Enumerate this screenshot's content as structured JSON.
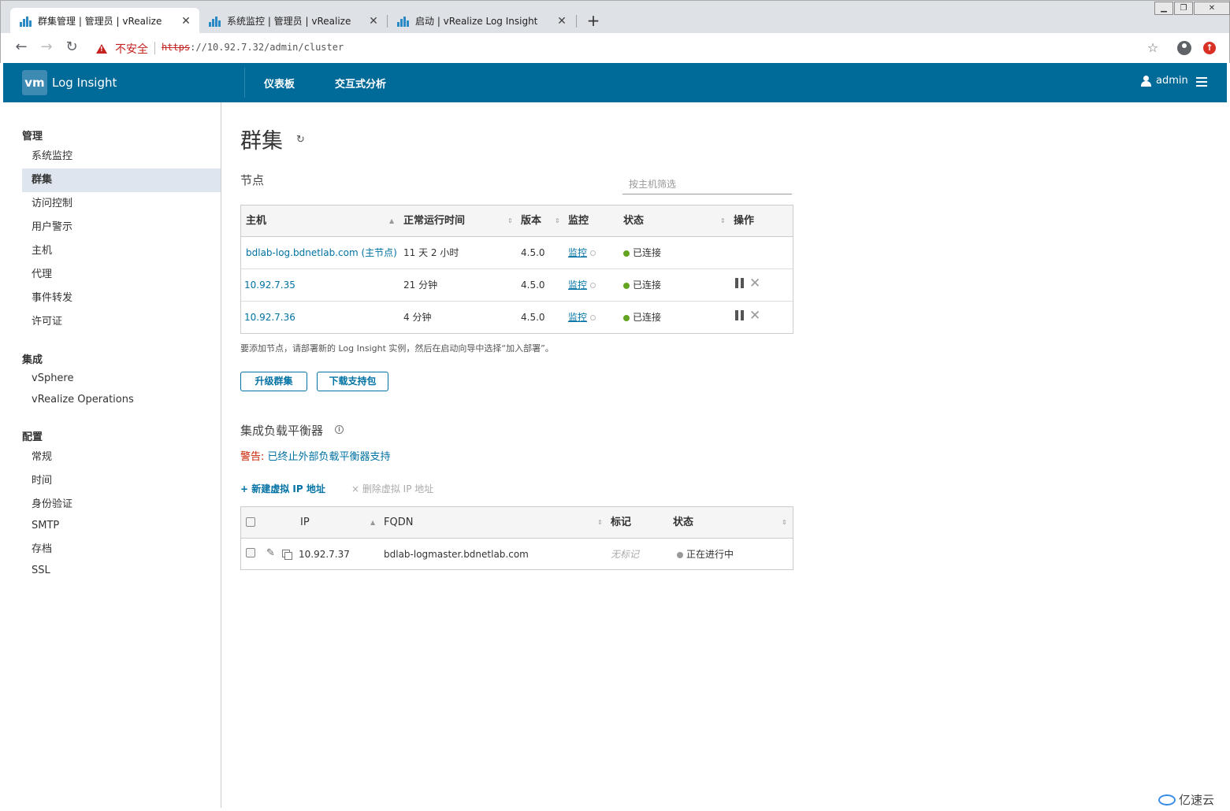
{
  "browser": {
    "tabs": [
      {
        "title": "群集管理 | 管理员 | vRealize",
        "active": true
      },
      {
        "title": "系统监控 | 管理员 | vRealize",
        "active": false
      },
      {
        "title": "启动 | vRealize Log Insight",
        "active": false
      }
    ],
    "new_tab_icon": "+",
    "security_label": "不安全",
    "url_scheme": "https",
    "url_rest": "://10.92.7.32/admin/cluster"
  },
  "header": {
    "logo_text": "vm",
    "product": "Log Insight",
    "nav": [
      "仪表板",
      "交互式分析"
    ],
    "user": "admin"
  },
  "sidebar": {
    "sections": [
      {
        "title": "管理",
        "items": [
          "系统监控",
          "群集",
          "访问控制",
          "用户警示",
          "主机",
          "代理",
          "事件转发",
          "许可证"
        ]
      },
      {
        "title": "集成",
        "items": [
          "vSphere",
          "vRealize Operations"
        ]
      },
      {
        "title": "配置",
        "items": [
          "常规",
          "时间",
          "身份验证",
          "SMTP",
          "存档",
          "SSL"
        ]
      }
    ],
    "active_item": "群集"
  },
  "page": {
    "title": "群集",
    "nodes_title": "节点",
    "filter_placeholder": "按主机筛选",
    "nodes_table": {
      "columns": [
        "主机",
        "正常运行时间",
        "版本",
        "监控",
        "状态",
        "操作"
      ],
      "rows": [
        {
          "host": "bdlab-log.bdnetlab.com (主节点)",
          "uptime": "11 天 2 小时",
          "version": "4.5.0",
          "monitor": "监控",
          "status": "已连接",
          "actions": false
        },
        {
          "host": "10.92.7.35",
          "uptime": "21 分钟",
          "version": "4.5.0",
          "monitor": "监控",
          "status": "已连接",
          "actions": true
        },
        {
          "host": "10.92.7.36",
          "uptime": "4 分钟",
          "version": "4.5.0",
          "monitor": "监控",
          "status": "已连接",
          "actions": true
        }
      ]
    },
    "hint": "要添加节点，请部署新的 Log Insight 实例，然后在启动向导中选择“加入部署”。",
    "buttons": {
      "upgrade": "升级群集",
      "download": "下载支持包"
    },
    "lb_title": "集成负载平衡器",
    "warning_label": "警告:",
    "warning_text": "已终止外部负载平衡器支持",
    "add_vip": "+ 新建虚拟 IP 地址",
    "delete_vip": "× 删除虚拟 IP 地址",
    "vip_table": {
      "columns": [
        "IP",
        "FQDN",
        "标记",
        "状态"
      ],
      "rows": [
        {
          "ip": "10.92.7.37",
          "fqdn": "bdlab-logmaster.bdnetlab.com",
          "tag": "无标记",
          "status": "正在进行中"
        }
      ]
    }
  },
  "watermark": "亿速云",
  "colors": {
    "header": "#006a99",
    "link": "#0072a3",
    "connected": "#62a420",
    "warning": "#c92100"
  }
}
